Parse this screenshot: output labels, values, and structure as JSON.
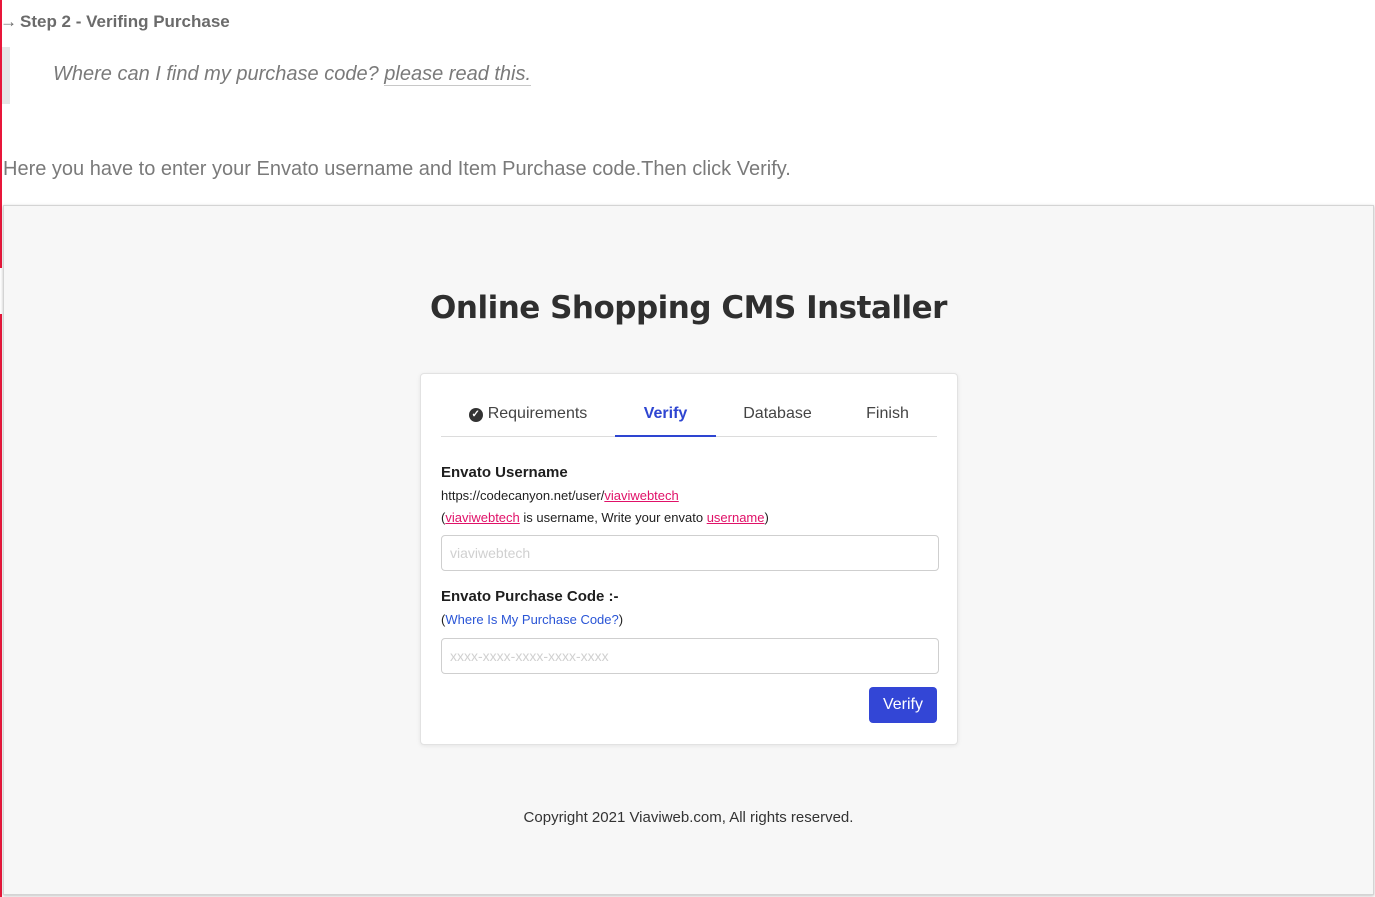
{
  "doc": {
    "step_arrow": "→",
    "step_heading": "Step 2 - Verifing Purchase",
    "quote_prefix": "Where can I find my purchase code?",
    "quote_link": "please read this.",
    "intro": "Here you have to enter your Envato username and Item Purchase code.Then click Verify."
  },
  "installer": {
    "title": "Online Shopping CMS Installer",
    "tabs": {
      "requirements": "Requirements",
      "verify": "Verify",
      "database": "Database",
      "finish": "Finish"
    },
    "username": {
      "label": "Envato Username",
      "url_prefix": "https://codecanyon.net/user/",
      "url_user": "viaviwebtech",
      "hint_open": "(",
      "hint_user": "viaviwebtech",
      "hint_middle": " is username, Write your envato ",
      "hint_link": "username",
      "hint_close": ")",
      "placeholder": "viaviwebtech",
      "value": ""
    },
    "purchase_code": {
      "label": "Envato Purchase Code :-",
      "hint_open": "(",
      "hint_link": "Where Is My Purchase Code?",
      "hint_close": ")",
      "placeholder": "xxxx-xxxx-xxxx-xxxx-xxxx",
      "value": ""
    },
    "verify_button": "Verify",
    "copyright": "Copyright 2021 Viaviweb.com, All rights reserved."
  },
  "colors": {
    "accent": "#3346d6",
    "link_pink": "#e01168",
    "link_blue": "#2a55d6",
    "page_edge": "#e8173a"
  },
  "icons": {
    "requirements_tab": "check-circle-icon"
  }
}
